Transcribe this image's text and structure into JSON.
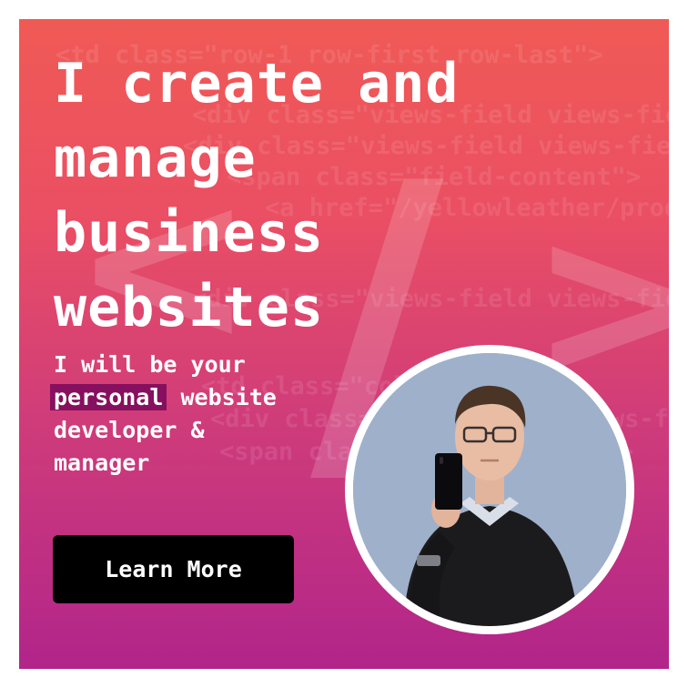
{
  "banner": {
    "headline_lines": [
      "I create and",
      "manage",
      "business",
      "websites"
    ],
    "subtitle_before": "I will be your",
    "subtitle_highlight": "personal",
    "subtitle_after": "website",
    "subtitle_line3": "developer &",
    "subtitle_line4": "manager",
    "cta_label": "Learn More"
  },
  "background_code": {
    "lines": [
      "<td class=\"row-1 row-first row-last\">",
      "<div class=\"views-field views-field-ti",
      "<div class=\"views-field views-field-uc",
      "<span class=\"field-content\">",
      "<a href=\"/yellowleather/produc",
      "<div class=\"views-field views-field-di",
      "<td class=\"col-2\">",
      "<div class=\"views-field views-field",
      "<span class=\"field-content\">"
    ],
    "big_glyph_left": "<",
    "big_glyph_slash": "/",
    "big_glyph_right": ">"
  },
  "colors": {
    "gradient_top": "#f05a55",
    "gradient_bottom": "#b1258a",
    "highlight_bg": "#86105f",
    "cta_bg": "#000000",
    "text": "#ffffff"
  },
  "icons": {
    "avatar": "portrait-photo"
  }
}
